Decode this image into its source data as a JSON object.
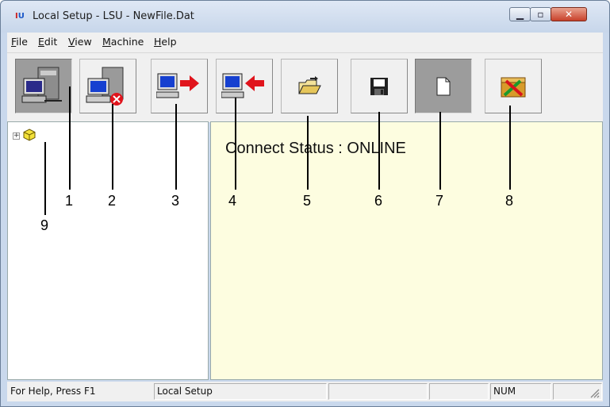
{
  "window": {
    "title": "Local Setup - LSU - NewFile.Dat",
    "app_icon_text": {
      "left": "I",
      "right": "U"
    }
  },
  "menu": [
    "File",
    "Edit",
    "View",
    "Machine",
    "Help"
  ],
  "toolbar": {
    "buttons": [
      {
        "name": "connect",
        "icon": "computer-connect-icon",
        "pressed": true
      },
      {
        "name": "disconnect",
        "icon": "computer-disconnect-icon",
        "pressed": false
      },
      {
        "name": "upload",
        "icon": "send-to-machine-icon",
        "pressed": false
      },
      {
        "name": "download",
        "icon": "receive-from-machine-icon",
        "pressed": false
      },
      {
        "name": "open-file",
        "icon": "open-folder-icon",
        "pressed": false
      },
      {
        "name": "save-file",
        "icon": "floppy-disk-icon",
        "pressed": false
      },
      {
        "name": "new-file",
        "icon": "blank-page-icon",
        "pressed": true
      },
      {
        "name": "settings",
        "icon": "tools-icon",
        "pressed": false
      }
    ]
  },
  "tree": {
    "root_icon": "cube-node-icon",
    "expander": "+"
  },
  "content": {
    "connect_status": "Connect Status : ONLINE"
  },
  "callouts": [
    "1",
    "2",
    "3",
    "4",
    "5",
    "6",
    "7",
    "8",
    "9"
  ],
  "statusbar": {
    "help": "For Help, Press F1",
    "mode": "Local Setup",
    "num": "NUM"
  },
  "colors": {
    "content_bg": "#fdfde0",
    "close_button": "#c8412a",
    "arrow_red": "#e0141c"
  }
}
